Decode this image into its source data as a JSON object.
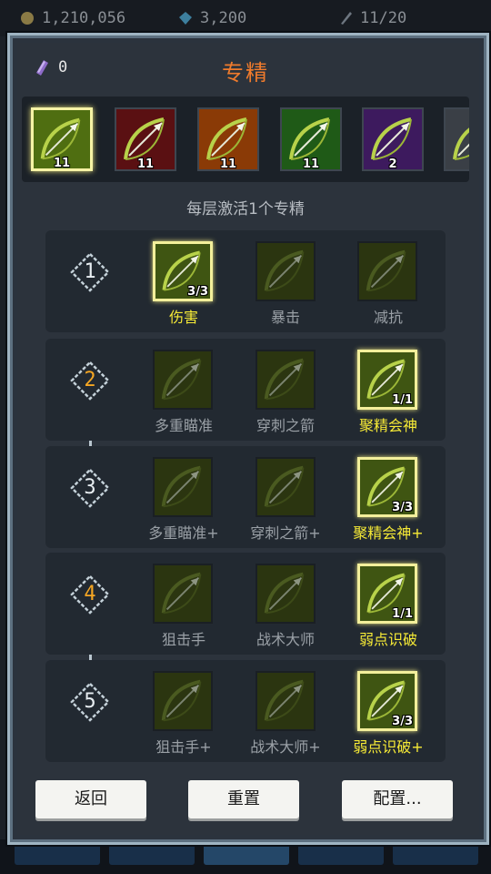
{
  "resources": [
    {
      "name": "gold",
      "value": "1,210,056",
      "color": "#c9a84a",
      "icon": "coin-icon"
    },
    {
      "name": "gems",
      "value": "3,200",
      "color": "#45a8d6",
      "icon": "gem-icon"
    },
    {
      "name": "energy",
      "value": "11/20",
      "color": "#8a96a3",
      "icon": "feather-icon"
    }
  ],
  "dialog": {
    "scroll_count": "0",
    "title": "专精",
    "subtitle": "每层激活1个专精"
  },
  "classes": [
    {
      "level": "11",
      "selected": true,
      "icon": "bow-arrow-icon",
      "bg": "#4f6e11"
    },
    {
      "level": "11",
      "selected": false,
      "icon": "crossbow-icon",
      "bg": "#5a1012"
    },
    {
      "level": "11",
      "selected": false,
      "icon": "fire-arrow-icon",
      "bg": "#8a3a06"
    },
    {
      "level": "11",
      "selected": false,
      "icon": "drawn-bow-icon",
      "bg": "#1f5a17"
    },
    {
      "level": "2",
      "selected": false,
      "icon": "shadow-blade-icon",
      "bg": "#3d1a5e"
    },
    {
      "level": "",
      "selected": false,
      "icon": "silver-blade-icon",
      "bg": "#3a3f46"
    }
  ],
  "tiers": [
    {
      "number": "1",
      "color": "#e8eef2",
      "talents": [
        {
          "name": "伤害",
          "count": "3/3",
          "active": true
        },
        {
          "name": "暴击",
          "count": "",
          "active": false
        },
        {
          "name": "减抗",
          "count": "",
          "active": false
        }
      ]
    },
    {
      "number": "2",
      "color": "#f5a623",
      "talents": [
        {
          "name": "多重瞄准",
          "count": "",
          "active": false
        },
        {
          "name": "穿刺之箭",
          "count": "",
          "active": false
        },
        {
          "name": "聚精会神",
          "count": "1/1",
          "active": true
        }
      ]
    },
    {
      "number": "3",
      "color": "#e8eef2",
      "talents": [
        {
          "name": "多重瞄准+",
          "count": "",
          "active": false
        },
        {
          "name": "穿刺之箭+",
          "count": "",
          "active": false
        },
        {
          "name": "聚精会神+",
          "count": "3/3",
          "active": true
        }
      ]
    },
    {
      "number": "4",
      "color": "#f5a623",
      "talents": [
        {
          "name": "狙击手",
          "count": "",
          "active": false
        },
        {
          "name": "战术大师",
          "count": "",
          "active": false
        },
        {
          "name": "弱点识破",
          "count": "1/1",
          "active": true
        }
      ]
    },
    {
      "number": "5",
      "color": "#e8eef2",
      "talents": [
        {
          "name": "狙击手+",
          "count": "",
          "active": false
        },
        {
          "name": "战术大师+",
          "count": "",
          "active": false
        },
        {
          "name": "弱点识破+",
          "count": "3/3",
          "active": true
        }
      ]
    }
  ],
  "buttons": {
    "back": "返回",
    "reset": "重置",
    "config": "配置..."
  }
}
